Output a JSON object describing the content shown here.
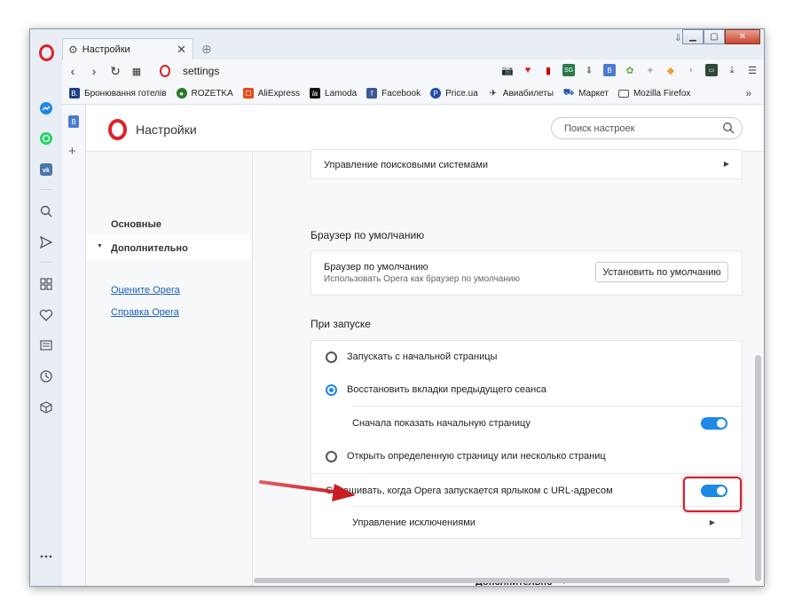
{
  "tab": {
    "title": "Настройки"
  },
  "address": {
    "url": "settings"
  },
  "bookmarks": [
    {
      "label": "Бронювання готелів",
      "icon": "booking-icon",
      "color": "#1e3f8a",
      "glyph": "B."
    },
    {
      "label": "ROZETKA",
      "icon": "rozetka-icon",
      "color": "#2a7a2a",
      "glyph": "●"
    },
    {
      "label": "AliExpress",
      "icon": "aliexpress-icon",
      "color": "#e34b1b",
      "glyph": "☐"
    },
    {
      "label": "Lamoda",
      "icon": "lamoda-icon",
      "color": "#111111",
      "glyph": "la"
    },
    {
      "label": "Facebook",
      "icon": "facebook-icon",
      "color": "#3b5998",
      "glyph": "f"
    },
    {
      "label": "Price.ua",
      "icon": "priceua-icon",
      "color": "#1f4aa8",
      "glyph": "P"
    },
    {
      "label": "Авиабилеты",
      "icon": "plane-icon",
      "color": "#444444",
      "glyph": "✈"
    },
    {
      "label": "Маркет",
      "icon": "cart-icon",
      "color": "#1e5aa8",
      "glyph": "🛒"
    },
    {
      "label": "Mozilla Firefox",
      "icon": "folder-icon",
      "color": "#555555",
      "glyph": "▭"
    }
  ],
  "header": {
    "title": "Настройки",
    "search_placeholder": "Поиск настроек"
  },
  "left_nav": {
    "basic": "Основные",
    "advanced": "Дополнительно",
    "rate_link": "Оцените Opera",
    "help_link": "Справка Opera"
  },
  "content": {
    "search_engines_row": "Управление поисковыми системами",
    "default_browser": {
      "section_title": "Браузер по умолчанию",
      "row_title": "Браузер по умолчанию",
      "row_subtitle": "Использовать Opera как браузер по умолчанию",
      "button": "Установить по умолчанию"
    },
    "startup": {
      "section_title": "При запуске",
      "option1": "Запускать с начальной страницы",
      "option2": "Восстановить вкладки предыдущего сеанса",
      "option2_sub": "Сначала показать начальную страницу",
      "option3": "Открыть определенную страницу или несколько страниц",
      "ask_url": "Спрашивать, когда Opera запускается ярлыком с URL-адресом",
      "manage_exceptions": "Управление исключениями",
      "selected_option": 2,
      "show_start_page_enabled": true,
      "ask_url_enabled": true
    },
    "advanced_footer": "Дополнительно"
  },
  "colors": {
    "accent": "#1e88e5",
    "opera_red": "#e0202a",
    "annotation_red": "#d21f2a"
  }
}
